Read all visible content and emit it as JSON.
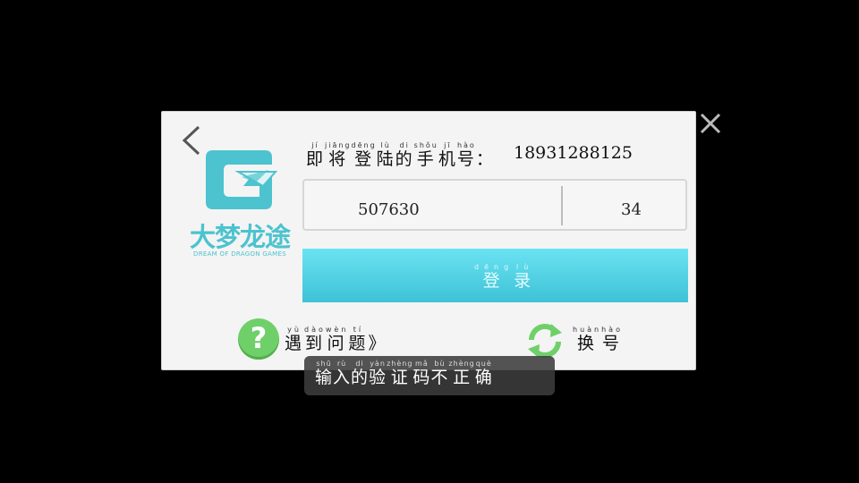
{
  "phone_prompt": {
    "chars": [
      {
        "c": "即",
        "p": "jí"
      },
      {
        "c": "将",
        "p": "jiāng"
      },
      {
        "c": "登",
        "p": "dēng"
      },
      {
        "c": "陆",
        "p": "lù"
      },
      {
        "c": "的",
        "p": "di"
      },
      {
        "c": "手",
        "p": "shǒu"
      },
      {
        "c": "机",
        "p": "jī"
      },
      {
        "c": "号",
        "p": "hào"
      },
      {
        "c": "：",
        "p": ""
      }
    ],
    "number": "18931288125"
  },
  "code_input": {
    "value": "507630",
    "count": "34"
  },
  "login_button": {
    "chars": [
      {
        "c": "登",
        "p": "dēng"
      },
      {
        "c": "录",
        "p": "lù"
      }
    ]
  },
  "help_link": {
    "icon": "question-icon",
    "icon_glyph": "?",
    "chars": [
      {
        "c": "遇",
        "p": "yù"
      },
      {
        "c": "到",
        "p": "dào"
      },
      {
        "c": "问",
        "p": "wèn"
      },
      {
        "c": "题",
        "p": "tí"
      },
      {
        "c": "》",
        "p": ""
      }
    ]
  },
  "switch_link": {
    "icon": "refresh-icon",
    "chars": [
      {
        "c": "换",
        "p": "huàn"
      },
      {
        "c": "号",
        "p": "hào"
      }
    ]
  },
  "toast": {
    "chars": [
      {
        "c": "输",
        "p": "shū"
      },
      {
        "c": "入",
        "p": "rù"
      },
      {
        "c": "的",
        "p": "di"
      },
      {
        "c": "验",
        "p": "yàn"
      },
      {
        "c": "证",
        "p": "zhèng"
      },
      {
        "c": "码",
        "p": "mǎ"
      },
      {
        "c": "不",
        "p": "bù"
      },
      {
        "c": "正",
        "p": "zhèng"
      },
      {
        "c": "确",
        "p": "què"
      }
    ]
  },
  "logo": {
    "title": "大梦龙途",
    "subtitle": "DREAM OF DRAGON GAMES"
  },
  "colors": {
    "accent": "#4cc3cf",
    "button": "#4fd0e2",
    "help": "#6fd06a"
  }
}
